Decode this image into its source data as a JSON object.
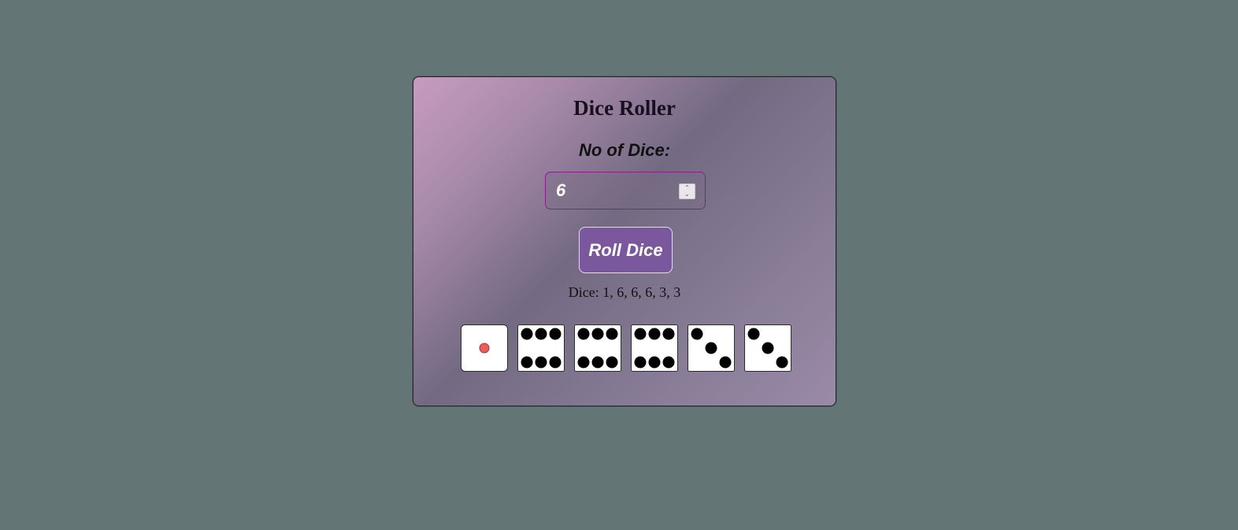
{
  "app": {
    "title": "Dice Roller",
    "count_label": "No of Dice:",
    "count_value": "6",
    "roll_button": "Roll Dice",
    "result_text": "Dice: 1, 6, 6, 6, 3, 3"
  },
  "dice": [
    1,
    6,
    6,
    6,
    3,
    3
  ],
  "colors": {
    "background": "#637574",
    "accent": "#7b589e",
    "input_border": "#8a1f8a",
    "single_pip": "#e85d5d",
    "pip": "#000000"
  },
  "icons": {
    "spinner_up": "chevron-up-icon",
    "spinner_down": "chevron-down-icon"
  }
}
